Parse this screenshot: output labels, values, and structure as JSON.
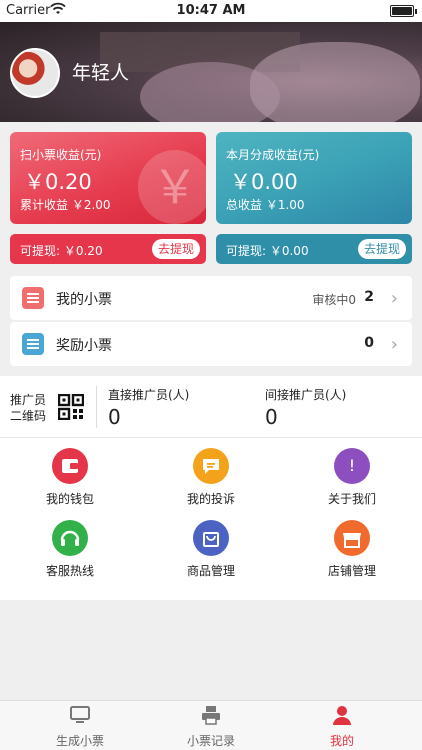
{
  "status_bar": {
    "carrier": "Carrier",
    "time": "10:47 AM"
  },
  "profile": {
    "username": "年轻人"
  },
  "cards": {
    "scan": {
      "title": "扫小票收益(元)",
      "amount": "￥0.20",
      "total": "累计收益 ￥2.00",
      "watermark": "￥"
    },
    "monthly": {
      "title": "本月分成收益(元)",
      "amount": "￥0.00",
      "total": "总收益 ￥1.00"
    }
  },
  "withdraw": {
    "left": {
      "label": "可提现: ￥0.20",
      "button": "去提现"
    },
    "right": {
      "label": "可提现: ￥0.00",
      "button": "去提现"
    }
  },
  "rows": [
    {
      "label": "我的小票",
      "status": "审核中0",
      "count": "2"
    },
    {
      "label": "奖励小票",
      "status": "",
      "count": "0"
    }
  ],
  "promoter": {
    "qr_label_line1": "推广员",
    "qr_label_line2": "二维码",
    "direct_label": "直接推广员(人)",
    "direct_value": "0",
    "indirect_label": "间接推广员(人)",
    "indirect_value": "0"
  },
  "grid": [
    {
      "label": "我的钱包",
      "icon": "wallet-icon"
    },
    {
      "label": "我的投诉",
      "icon": "complaint-icon"
    },
    {
      "label": "关于我们",
      "icon": "info-icon"
    },
    {
      "label": "客服热线",
      "icon": "headset-icon"
    },
    {
      "label": "商品管理",
      "icon": "shopping-bag-icon"
    },
    {
      "label": "店铺管理",
      "icon": "store-icon"
    }
  ],
  "tabs": [
    {
      "label": "生成小票",
      "icon": "monitor-icon"
    },
    {
      "label": "小票记录",
      "icon": "printer-icon"
    },
    {
      "label": "我的",
      "icon": "person-icon"
    }
  ],
  "colors": {
    "accent_red": "#e5364b",
    "accent_teal": "#2f8fa8"
  }
}
